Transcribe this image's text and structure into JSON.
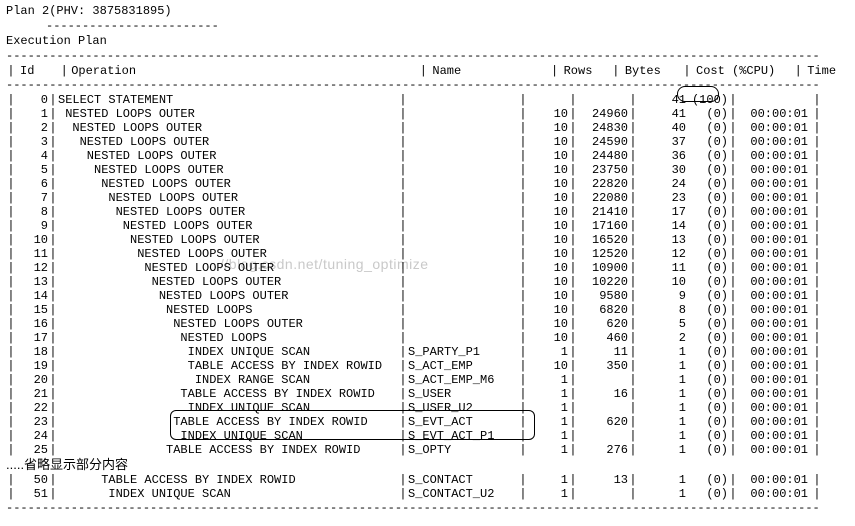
{
  "title_line": "Plan 2(PHV: 3875831895)",
  "subtitle": "Execution Plan",
  "watermark_text": "//blog.csdn.net/tuning_optimize",
  "dash_short": "------------------------",
  "dash_long": "-----------------------------------------------------------------------------------------------------------------",
  "ellipsis_note": ".....省略显示部分内容",
  "headers": {
    "id": "Id",
    "operation": "Operation",
    "name": "Name",
    "rows": "Rows",
    "bytes": "Bytes",
    "cost": "Cost (%CPU)",
    "time": "Time"
  },
  "rows": [
    {
      "id": "0",
      "indent": 0,
      "op": "SELECT STATEMENT",
      "name": "",
      "rows": "",
      "bytes": "",
      "cost": "41",
      "cpu": "(100)",
      "time": ""
    },
    {
      "id": "1",
      "indent": 1,
      "op": "NESTED LOOPS OUTER",
      "name": "",
      "rows": "10",
      "bytes": "24960",
      "cost": "41",
      "cpu": "(0)",
      "time": "00:00:01"
    },
    {
      "id": "2",
      "indent": 2,
      "op": "NESTED LOOPS OUTER",
      "name": "",
      "rows": "10",
      "bytes": "24830",
      "cost": "40",
      "cpu": "(0)",
      "time": "00:00:01"
    },
    {
      "id": "3",
      "indent": 3,
      "op": "NESTED LOOPS OUTER",
      "name": "",
      "rows": "10",
      "bytes": "24590",
      "cost": "37",
      "cpu": "(0)",
      "time": "00:00:01"
    },
    {
      "id": "4",
      "indent": 4,
      "op": "NESTED LOOPS OUTER",
      "name": "",
      "rows": "10",
      "bytes": "24480",
      "cost": "36",
      "cpu": "(0)",
      "time": "00:00:01"
    },
    {
      "id": "5",
      "indent": 5,
      "op": "NESTED LOOPS OUTER",
      "name": "",
      "rows": "10",
      "bytes": "23750",
      "cost": "30",
      "cpu": "(0)",
      "time": "00:00:01"
    },
    {
      "id": "6",
      "indent": 6,
      "op": "NESTED LOOPS OUTER",
      "name": "",
      "rows": "10",
      "bytes": "22820",
      "cost": "24",
      "cpu": "(0)",
      "time": "00:00:01"
    },
    {
      "id": "7",
      "indent": 7,
      "op": "NESTED LOOPS OUTER",
      "name": "",
      "rows": "10",
      "bytes": "22080",
      "cost": "23",
      "cpu": "(0)",
      "time": "00:00:01"
    },
    {
      "id": "8",
      "indent": 8,
      "op": "NESTED LOOPS OUTER",
      "name": "",
      "rows": "10",
      "bytes": "21410",
      "cost": "17",
      "cpu": "(0)",
      "time": "00:00:01"
    },
    {
      "id": "9",
      "indent": 9,
      "op": "NESTED LOOPS OUTER",
      "name": "",
      "rows": "10",
      "bytes": "17160",
      "cost": "14",
      "cpu": "(0)",
      "time": "00:00:01"
    },
    {
      "id": "10",
      "indent": 10,
      "op": "NESTED LOOPS OUTER",
      "name": "",
      "rows": "10",
      "bytes": "16520",
      "cost": "13",
      "cpu": "(0)",
      "time": "00:00:01"
    },
    {
      "id": "11",
      "indent": 11,
      "op": "NESTED LOOPS OUTER",
      "name": "",
      "rows": "10",
      "bytes": "12520",
      "cost": "12",
      "cpu": "(0)",
      "time": "00:00:01"
    },
    {
      "id": "12",
      "indent": 12,
      "op": "NESTED LOOPS OUTER",
      "name": "",
      "rows": "10",
      "bytes": "10900",
      "cost": "11",
      "cpu": "(0)",
      "time": "00:00:01"
    },
    {
      "id": "13",
      "indent": 13,
      "op": "NESTED LOOPS OUTER",
      "name": "",
      "rows": "10",
      "bytes": "10220",
      "cost": "10",
      "cpu": "(0)",
      "time": "00:00:01"
    },
    {
      "id": "14",
      "indent": 14,
      "op": "NESTED LOOPS OUTER",
      "name": "",
      "rows": "10",
      "bytes": "9580",
      "cost": "9",
      "cpu": "(0)",
      "time": "00:00:01"
    },
    {
      "id": "15",
      "indent": 15,
      "op": "NESTED LOOPS",
      "name": "",
      "rows": "10",
      "bytes": "6820",
      "cost": "8",
      "cpu": "(0)",
      "time": "00:00:01"
    },
    {
      "id": "16",
      "indent": 16,
      "op": "NESTED LOOPS OUTER",
      "name": "",
      "rows": "10",
      "bytes": "620",
      "cost": "5",
      "cpu": "(0)",
      "time": "00:00:01"
    },
    {
      "id": "17",
      "indent": 17,
      "op": "NESTED LOOPS",
      "name": "",
      "rows": "10",
      "bytes": "460",
      "cost": "2",
      "cpu": "(0)",
      "time": "00:00:01"
    },
    {
      "id": "18",
      "indent": 18,
      "op": "INDEX UNIQUE SCAN",
      "name": "S_PARTY_P1",
      "rows": "1",
      "bytes": "11",
      "cost": "1",
      "cpu": "(0)",
      "time": "00:00:01"
    },
    {
      "id": "19",
      "indent": 18,
      "op": "TABLE ACCESS BY INDEX ROWID",
      "name": "S_ACT_EMP",
      "rows": "10",
      "bytes": "350",
      "cost": "1",
      "cpu": "(0)",
      "time": "00:00:01"
    },
    {
      "id": "20",
      "indent": 19,
      "op": "INDEX RANGE SCAN",
      "name": "S_ACT_EMP_M6",
      "rows": "1",
      "bytes": "",
      "cost": "1",
      "cpu": "(0)",
      "time": "00:00:01"
    },
    {
      "id": "21",
      "indent": 17,
      "op": "TABLE ACCESS BY INDEX ROWID",
      "name": "S_USER",
      "rows": "1",
      "bytes": "16",
      "cost": "1",
      "cpu": "(0)",
      "time": "00:00:01"
    },
    {
      "id": "22",
      "indent": 18,
      "op": "INDEX UNIQUE SCAN",
      "name": "S_USER_U2",
      "rows": "1",
      "bytes": "",
      "cost": "1",
      "cpu": "(0)",
      "time": "00:00:01"
    },
    {
      "id": "23",
      "indent": 16,
      "op": "TABLE ACCESS BY INDEX ROWID",
      "name": "S_EVT_ACT",
      "rows": "1",
      "bytes": "620",
      "cost": "1",
      "cpu": "(0)",
      "time": "00:00:01"
    },
    {
      "id": "24",
      "indent": 17,
      "op": "INDEX UNIQUE SCAN",
      "name": "S_EVT_ACT_P1",
      "rows": "1",
      "bytes": "",
      "cost": "1",
      "cpu": "(0)",
      "time": "00:00:01"
    },
    {
      "id": "25",
      "indent": 15,
      "op": "TABLE ACCESS BY INDEX ROWID",
      "name": "S_OPTY",
      "rows": "1",
      "bytes": "276",
      "cost": "1",
      "cpu": "(0)",
      "time": "00:00:01"
    }
  ],
  "tail_rows": [
    {
      "id": "50",
      "indent": 6,
      "op": "TABLE ACCESS BY INDEX ROWID",
      "name": "S_CONTACT",
      "rows": "1",
      "bytes": "13",
      "cost": "1",
      "cpu": "(0)",
      "time": "00:00:01"
    },
    {
      "id": "51",
      "indent": 7,
      "op": "INDEX UNIQUE SCAN",
      "name": "S_CONTACT_U2",
      "rows": "1",
      "bytes": "",
      "cost": "1",
      "cpu": "(0)",
      "time": "00:00:01"
    }
  ]
}
